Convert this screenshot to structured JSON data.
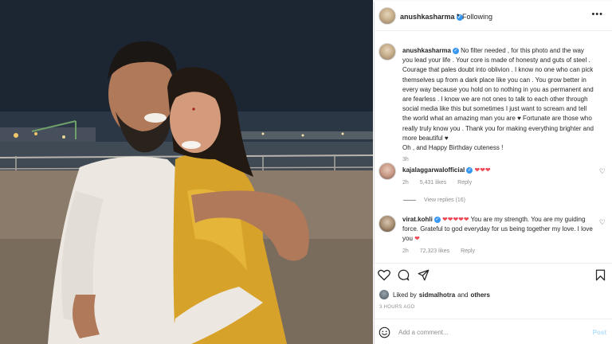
{
  "post": {
    "username": "anushkasharma",
    "verified_mark": "✓",
    "follow_state": "Following",
    "more_label": "•••"
  },
  "caption": {
    "username": "anushkasharma",
    "text": "No filter needed , for this photo and the way you lead your life . Your core is made of honesty and guts of steel . Courage that pales doubt into oblivion . I know no one who can pick themselves up from a dark place like you can . You grow better in every way because you hold on to nothing in you as permanent and are fearless . I know we are not ones to talk to each other through social media like this but sometimes I just want to scream and tell the world what an amazing man you are ♥ Fortunate are those who really truly know you . Thank you for making everything brighter and more beautiful ♥",
    "text2": "Oh , and Happy Birthday cuteness !",
    "age": "3h"
  },
  "comments": [
    {
      "username": "kajalaggarwalofficial",
      "text": "❤❤❤",
      "age": "2h",
      "likes": "5,431 likes",
      "reply": "Reply",
      "view_replies": "View replies (16)"
    },
    {
      "username": "virat.kohli",
      "hearts": "❤❤❤❤❤",
      "text": "You are my strength. You are my guiding force. Grateful to god everyday for us being together my love. I love you",
      "end_heart": "❤",
      "age": "2h",
      "likes": "72,323 likes",
      "reply": "Reply"
    }
  ],
  "likes_line": {
    "prefix": "Liked by",
    "user": "sidmalhotra",
    "and": "and",
    "others": "others"
  },
  "timestamp": "3 HOURS AGO",
  "add_comment": {
    "placeholder": "Add a comment...",
    "post_label": "Post"
  },
  "icons": {
    "heart": "heart-icon",
    "comment": "comment-icon",
    "share": "share-icon",
    "save": "bookmark-icon",
    "emoji": "smiley-icon"
  },
  "colors": {
    "verified": "#3897f0",
    "heart_red": "#ed4956",
    "post_disabled": "#b2dffc"
  }
}
